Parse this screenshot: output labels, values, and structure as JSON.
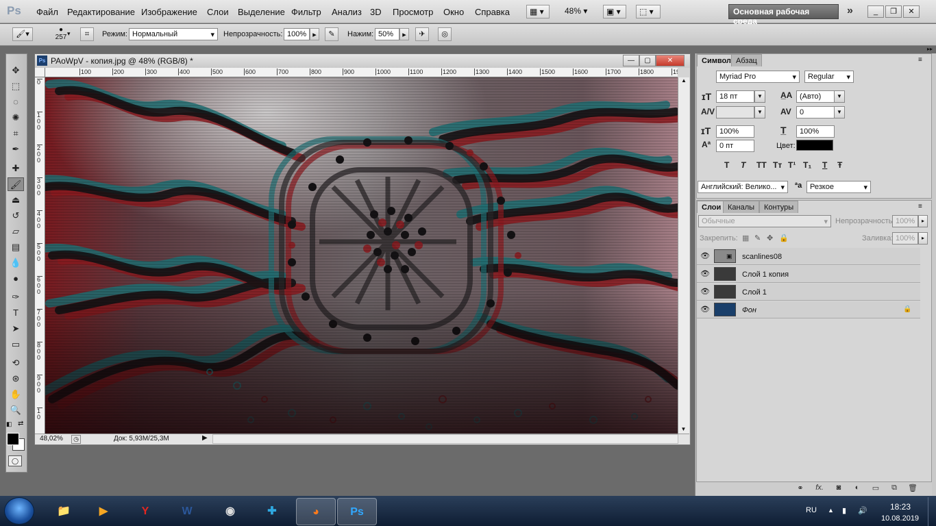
{
  "app": {
    "logo": "Ps",
    "menu": [
      "Файл",
      "Редактирование",
      "Изображение",
      "Слои",
      "Выделение",
      "Фильтр",
      "Анализ",
      "3D",
      "Просмотр",
      "Окно",
      "Справка"
    ],
    "zoom_value": "48%",
    "workspace": "Основная рабочая среда"
  },
  "options_bar": {
    "brush_size": "257",
    "mode_label": "Режим:",
    "mode_value": "Нормальный",
    "opacity_label": "Непрозрачность:",
    "opacity_value": "100%",
    "flow_label": "Нажим:",
    "flow_value": "50%"
  },
  "document": {
    "icon": "Ps",
    "title": "PAoWpV - копия.jpg @ 48% (RGB/8) *",
    "zoom": "48,02%",
    "doc_info": "Док: 5,93M/25,3M",
    "ruler_h": [
      "100",
      "200",
      "300",
      "400",
      "500",
      "600",
      "700",
      "800",
      "900",
      "1000",
      "1100",
      "1200",
      "1300",
      "1400",
      "1500",
      "1600",
      "1700",
      "1800",
      "19"
    ],
    "ruler_v": [
      "0",
      "1 0 0",
      "2 0 0",
      "3 0 0",
      "4 0 0",
      "5 0 0",
      "6 0 0",
      "7 0 0",
      "8 0 0",
      "9 0 0",
      "1 0"
    ]
  },
  "character_panel": {
    "tabs": [
      "Символ",
      "Абзац"
    ],
    "font_family": "Myriad Pro",
    "font_style": "Regular",
    "font_size": "18 пт",
    "leading": "(Авто)",
    "tracking": "0",
    "vertical_scale": "100%",
    "horizontal_scale": "100%",
    "baseline_shift": "0 пт",
    "color_label": "Цвет:",
    "color_value": "#000000",
    "style_buttons": [
      "T",
      "T",
      "TT",
      "Tт",
      "T¹",
      "T₁",
      "T",
      "Ŧ"
    ],
    "language": "Английский: Велико...",
    "aa_label": "ªa",
    "antialias": "Резкое"
  },
  "layers_panel": {
    "tabs": [
      "Слои",
      "Каналы",
      "Контуры"
    ],
    "blend_mode": "Обычные",
    "opacity_label": "Непрозрачность:",
    "opacity_value": "100%",
    "lock_label": "Закрепить:",
    "fill_label": "Заливка:",
    "fill_value": "100%",
    "layers": [
      {
        "name": "scanlines08",
        "thumb": "#8a8a8a"
      },
      {
        "name": "Слой 1 копия",
        "thumb": "#3a3a3a"
      },
      {
        "name": "Слой 1",
        "thumb": "#3a3a3a"
      },
      {
        "name": "Фон",
        "thumb": "#1a3f6a",
        "locked": true
      }
    ],
    "footer_icons": [
      "link-icon",
      "fx-icon",
      "mask-icon",
      "adjustment-icon",
      "group-icon",
      "new-layer-icon",
      "trash-icon"
    ]
  },
  "taskbar": {
    "apps": [
      "explorer",
      "media-player",
      "yandex",
      "word",
      "obs",
      "download",
      "firefox",
      "photoshop"
    ],
    "lang": "RU",
    "time": "18:23",
    "date": "10.08.2019"
  },
  "colors": {
    "canvas_red": "#8b1a1f",
    "canvas_cyan": "#1f6f73",
    "ui_gray": "#d6d6d6"
  }
}
